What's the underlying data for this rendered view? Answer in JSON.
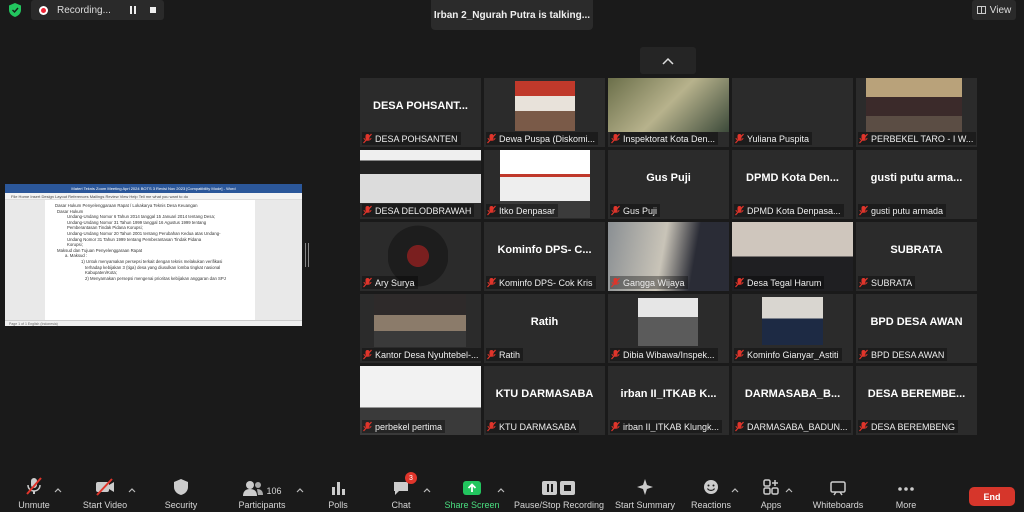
{
  "topbar": {
    "recording_label": "Recording...",
    "active_speaker": "Irban 2_Ngurah Putra is talking...",
    "view_label": "View"
  },
  "shared_screen": {
    "window_title": "Materi Teknis Zoom Meeting Apri 2024 BOTS 3 Revisi Nov 2023 [Compatibility Mode] - Word",
    "ribbon": "File   Home   Insert   Design   Layout   References   Mailings   Review   View   Help   Tell me what you want to do",
    "lines": [
      "Dasar Hukum Penyelenggaraan Rapat / Lokakarya Teknis Desa Keuangan",
      "Dasar Hukum",
      "Undang-Undang Nomor 6 Tahun 2014 tanggal 15 Januari 2014 tentang Desa;",
      "Undang-Undang Nomor 31 Tahun 1999 tanggal 16 Agustus 1999 tentang",
      "Pemberantasan Tindak Pidana Korupsi;",
      "Undang-Undang Nomor 20 Tahun 2001 tentang Perubahan Kedua atas Undang-",
      "Undang Nomor 31 Tahun 1999 tentang Pemberantasan Tindak Pidana",
      "Korupsi;",
      "",
      "Maksud dan Tujuan Penyelenggaraan Rapat",
      "a. Maksud :",
      "1) Untuk menyamakan persepsi terkait dengan teknis melakukan verifikasi",
      "terhadap kebijakan 3 (tiga) desa yang diusulkan lomba tingkat nasional",
      "Kabupaten/Kota;",
      "2) Menyamakan persepsi mengenai prioritas kebijakan anggaran dan SPJ"
    ],
    "status": "Page 1 of 1   English (Indonesia)"
  },
  "participants": [
    {
      "name": "DESA POHSANTEN",
      "big": "DESA POHSANT...",
      "video": false
    },
    {
      "name": "Dewa Puspa (Diskomi...",
      "big": "",
      "video": true
    },
    {
      "name": "Inspektorat Kota Den...",
      "big": "",
      "video": true
    },
    {
      "name": "Yuliana Puspita",
      "big": "",
      "video": false
    },
    {
      "name": "PERBEKEL TARO - I W...",
      "big": "",
      "video": true
    },
    {
      "name": "DESA DELODBRAWAH",
      "big": "",
      "video": true
    },
    {
      "name": "Itko Denpasar",
      "big": "",
      "video": true
    },
    {
      "name": "Gus Puji",
      "big": "Gus Puji",
      "video": false
    },
    {
      "name": "DPMD Kota Denpasa...",
      "big": "DPMD Kota Den...",
      "video": false
    },
    {
      "name": "gusti putu armada",
      "big": "gusti putu arma...",
      "video": false
    },
    {
      "name": "Ary Surya",
      "big": "",
      "video": true
    },
    {
      "name": "Kominfo DPS- Cok Kris",
      "big": "Kominfo DPS- C...",
      "video": false
    },
    {
      "name": "Gangga Wijaya",
      "big": "",
      "video": true
    },
    {
      "name": "Desa Tegal Harum",
      "big": "",
      "video": true
    },
    {
      "name": "SUBRATA",
      "big": "SUBRATA",
      "video": false
    },
    {
      "name": "Kantor Desa Nyuhtebel-...",
      "big": "",
      "video": true
    },
    {
      "name": "Ratih",
      "big": "Ratih",
      "video": false
    },
    {
      "name": "Dibia Wibawa/Inspek...",
      "big": "",
      "video": true
    },
    {
      "name": "Kominfo Gianyar_Astiti",
      "big": "",
      "video": true
    },
    {
      "name": "BPD DESA AWAN",
      "big": "BPD DESA AWAN",
      "video": false
    },
    {
      "name": "perbekel pertima",
      "big": "",
      "video": true
    },
    {
      "name": "KTU DARMASABA",
      "big": "KTU DARMASABA",
      "video": false
    },
    {
      "name": "irban II_ITKAB Klungk...",
      "big": "irban II_ITKAB K...",
      "video": false
    },
    {
      "name": "DARMASABA_BADUN...",
      "big": "DARMASABA_B...",
      "video": false
    },
    {
      "name": "DESA BEREMBENG",
      "big": "DESA BEREMBE...",
      "video": false
    }
  ],
  "toolbar": {
    "unmute": "Unmute",
    "start_video": "Start Video",
    "security": "Security",
    "participants": "Participants",
    "participants_count": "106",
    "polls": "Polls",
    "chat": "Chat",
    "chat_badge": "3",
    "share_screen": "Share Screen",
    "recording": "Pause/Stop Recording",
    "summary": "Start Summary",
    "reactions": "Reactions",
    "apps": "Apps",
    "whiteboards": "Whiteboards",
    "more": "More",
    "end": "End"
  },
  "colors": {
    "background": "#1a1a1a",
    "tile": "#2b2b2b",
    "muted_red": "#e0352b",
    "share_green": "#22c55e",
    "end_red": "#d6362b",
    "word_blue": "#2b579a"
  }
}
